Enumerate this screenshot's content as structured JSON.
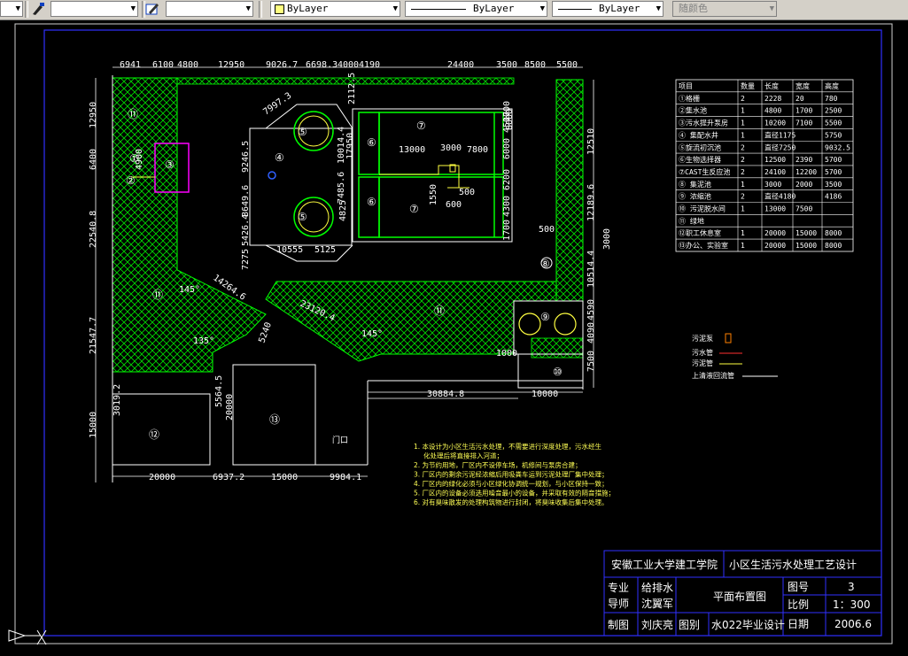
{
  "toolbar": {
    "dropdown1_value": "",
    "dropdown2_value": "",
    "layer_value": "ByLayer",
    "linetype_value": "ByLayer",
    "lineweight_value": "ByLayer",
    "plotstyle_value": "随颜色"
  },
  "dimensions": {
    "top": [
      "6941",
      "6100",
      "4800",
      "12950",
      "9026.7",
      "6698.3",
      "4000",
      "4190",
      "24400",
      "3500",
      "8500",
      "5500"
    ],
    "left": [
      "12950",
      "6400",
      "22540.8",
      "21547.7",
      "3019.2",
      "15000"
    ],
    "right": [
      "12510",
      "12189.6",
      "3000",
      "10514.4",
      "4590",
      "4090",
      "7500"
    ],
    "bottom_row": [
      "20000",
      "6937.2",
      "15000",
      "9984.1"
    ],
    "inner": {
      "d7997": "7997.3",
      "d2112": "2112.5",
      "d9246": "9246.5",
      "d8649": "8649.6",
      "d5426": "5426.4",
      "d7275": "7275",
      "d4825": "4825",
      "d10555": "10555",
      "d5125": "5125",
      "d10014": "10014.4",
      "d17950": "17950",
      "d7485": "7485.6",
      "d13000": "13000",
      "d3000": "3000",
      "d7800": "7800",
      "d1550": "1550",
      "d500a": "500",
      "d600": "600",
      "d6000a": "6000",
      "d4500": "4500",
      "d6200": "6200",
      "d4300": "4300",
      "d1700a": "1700",
      "d1700b": "1700",
      "d4900": "4900",
      "d500b": "500",
      "d14264": "14264.6",
      "d5240": "5240",
      "d23120": "23120.4",
      "d1000": "1000",
      "d30884": "30884.8",
      "d10000": "10000",
      "d5564": "5564.5",
      "d20000v": "20000",
      "d145": "145°",
      "d135": "135°",
      "d145b": "145°",
      "d8000": "8000"
    }
  },
  "labels": {
    "n1": "①",
    "n2": "②",
    "n3": "③",
    "n4": "④",
    "n5a": "⑤",
    "n5b": "⑤",
    "n6a": "⑥",
    "n6b": "⑥",
    "n7a": "⑦",
    "n7b": "⑦",
    "n8": "⑧",
    "n9": "⑨",
    "n10": "⑩",
    "n11a": "⑪",
    "n11b": "⑪",
    "n11c": "⑪",
    "n12": "⑫",
    "n13": "⑬",
    "door": "门口"
  },
  "table": {
    "headers": [
      "项目",
      "数量",
      "长度",
      "宽度",
      "高度"
    ],
    "rows": [
      [
        "①格栅",
        "2",
        "2228",
        "20",
        "780"
      ],
      [
        "②集水池",
        "1",
        "4800",
        "1700",
        "2500"
      ],
      [
        "③污水提升泵房",
        "1",
        "10200",
        "7100",
        "5500"
      ],
      [
        "④ 集配水井",
        "1",
        "直径1175",
        "",
        "5750"
      ],
      [
        "⑤旋流初沉池",
        "2",
        "直径7250",
        "",
        "9032.5"
      ],
      [
        "⑥生物选择器",
        "2",
        "12500",
        "2390",
        "5700"
      ],
      [
        "⑦CAST生反应池",
        "2",
        "24100",
        "12200",
        "5700"
      ],
      [
        "⑧ 集泥池",
        "1",
        "3000",
        "2000",
        "3500"
      ],
      [
        "⑨ 浓缩池",
        "2",
        "直径4180",
        "",
        "4186"
      ],
      [
        "⑩ 污泥脱水间",
        "1",
        "13000",
        "7500",
        ""
      ],
      [
        "⑪ 绿地",
        "",
        "",
        "",
        ""
      ],
      [
        "⑫职工休息室",
        "1",
        "20000",
        "15000",
        "8000"
      ],
      [
        "⑬办公、实验室",
        "1",
        "20000",
        "15000",
        "8000"
      ]
    ]
  },
  "legend": {
    "l1": "污泥泵",
    "l2": "污水管",
    "l3": "污泥管",
    "l4": "上清液回流管"
  },
  "notes": [
    "1. 本设计为小区生活污水处理，不需要进行深度处理，污水经生",
    "化处理后将直接排入河道；",
    "2. 为节约用地，厂区内不设停车场，机修间与泵房合建；",
    "3. 厂区内的剩余污泥经浓缩后用吸粪车运到污泥处理厂集中处理；",
    "4. 厂区内的绿化必须与小区绿化协调统一规划，与小区保持一致；",
    "5. 厂区内的设备必须选用噪音最小的设备，并采取有效的隔音措施；",
    "6. 对有臭味散发的处理构筑物进行封闭，将臭味收集后集中处理。"
  ],
  "title_block": {
    "school": "安徽工业大学建工学院",
    "project": "小区生活污水处理工艺设计",
    "major_label": "专业",
    "major_value": "给排水",
    "drawing_name": "平面布置图",
    "drawing_no_label": "图号",
    "drawing_no_value": "3",
    "advisor_label": "导师",
    "advisor_value": "沈翼军",
    "scale_label": "比例",
    "scale_value": "1：300",
    "drafter_label": "制图",
    "drafter_value": "刘庆亮",
    "category_label": "图别",
    "category_value": "水022毕业设计",
    "date_label": "日期",
    "date_value": "2006.6"
  },
  "colors": {
    "background": "#000000",
    "green": "#00ff00",
    "frame_blue": "#3030ff",
    "magenta": "#ff00ff",
    "yellow_note": "#ffff55",
    "red_legend": "#ff3030"
  }
}
